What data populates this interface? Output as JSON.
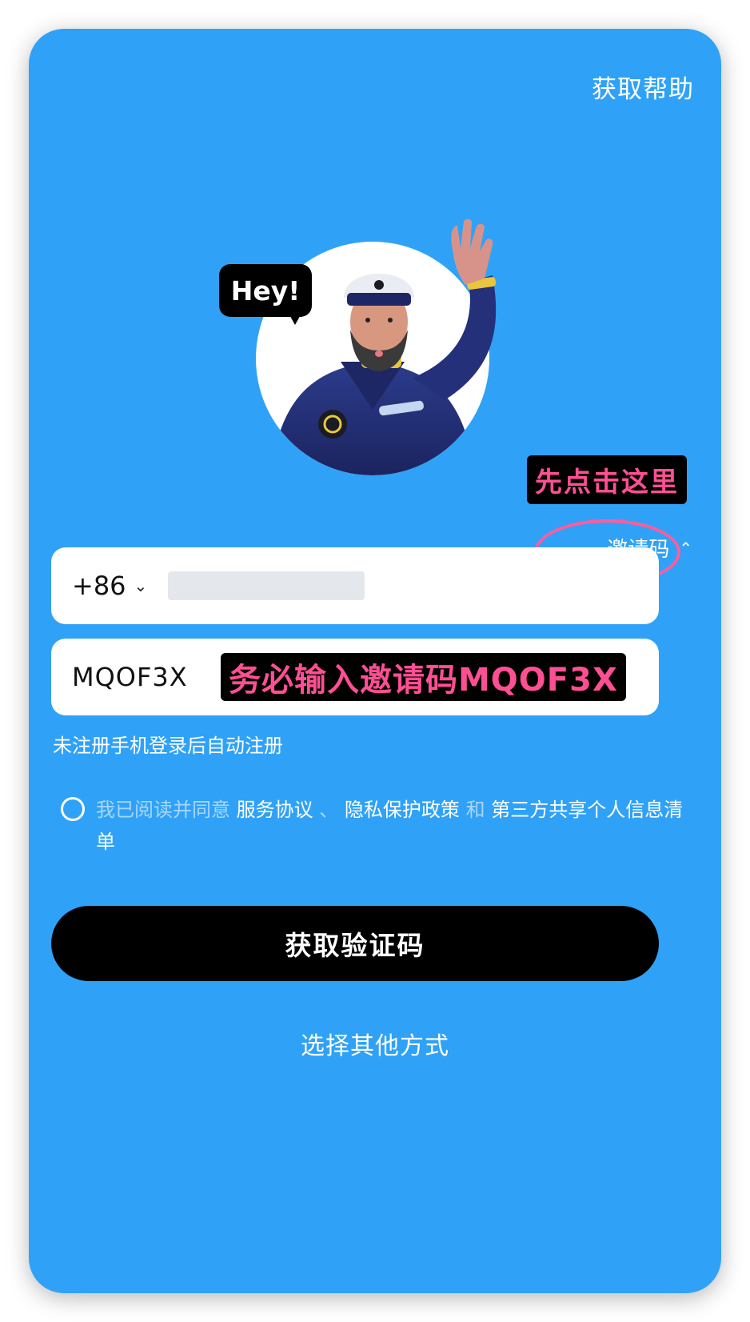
{
  "header": {
    "help_label": "获取帮助"
  },
  "hero": {
    "bubble_text": "Hey!"
  },
  "annotations": {
    "click_here": "先点击这里",
    "enter_code_note": "务必输入邀请码MQOF3X"
  },
  "invite_toggle": {
    "label": "邀请码",
    "icon": "chevron-up-icon"
  },
  "phone_field": {
    "country_code": "+86",
    "icon": "chevron-down-icon",
    "value": ""
  },
  "invite_field": {
    "value": "MQOF3X"
  },
  "auto_register_note": "未注册手机登录后自动注册",
  "agreement": {
    "prefix": "我已阅读并同意",
    "service": "服务协议",
    "separator": "、",
    "privacy": "隐私保护政策",
    "and": "和",
    "third_party": "第三方共享个人信息清单"
  },
  "primary_button": {
    "label": "获取验证码"
  },
  "alt_link": {
    "label": "选择其他方式"
  },
  "colors": {
    "background": "#2FA2F7",
    "accent_pink": "#FF4F94",
    "button": "#000000"
  }
}
